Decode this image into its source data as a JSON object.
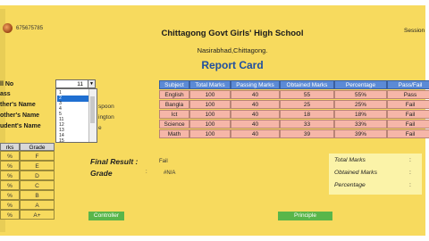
{
  "header": {
    "phone": "675675785",
    "school": "Chittagong Govt Girls' High School",
    "address": "Nasirabhad,Chittagong.",
    "report_title": "Report Card",
    "session_label": "Session"
  },
  "left_labels": {
    "roll_no": "ll No",
    "class": "ass",
    "fathers_name": "ther's Name",
    "mothers_name": "other's Name",
    "students_name": "udent's Name"
  },
  "roll_input": {
    "value": "11"
  },
  "roll_dropdown": {
    "options": [
      "1",
      "2",
      "3",
      "4",
      "5",
      "11",
      "12",
      "13",
      "14",
      "15"
    ],
    "selected_index": 1
  },
  "partial_info": [
    "spoon",
    "ington",
    "e"
  ],
  "grade_scale": {
    "headers": [
      "rks",
      "Grade"
    ],
    "rows": [
      [
        "%",
        "F"
      ],
      [
        "%",
        "E"
      ],
      [
        "%",
        "D"
      ],
      [
        "%",
        "C"
      ],
      [
        "%",
        "B"
      ],
      [
        "%",
        "A"
      ],
      [
        "%",
        "A+"
      ]
    ]
  },
  "marks_table": {
    "headers": [
      "Subject",
      "Total Marks",
      "Passing Marks",
      "Obtained Marks",
      "Percentage",
      "Pass/Fail"
    ],
    "rows": [
      [
        "English",
        "100",
        "40",
        "55",
        "55%",
        "Pass"
      ],
      [
        "Bangla",
        "100",
        "40",
        "25",
        "25%",
        "Fail"
      ],
      [
        "Ict",
        "100",
        "40",
        "18",
        "18%",
        "Fail"
      ],
      [
        "Science",
        "100",
        "40",
        "33",
        "33%",
        "Fail"
      ],
      [
        "Math",
        "100",
        "40",
        "39",
        "39%",
        "Fail"
      ]
    ]
  },
  "final_result": {
    "label": "Final Result :",
    "value": "Fail"
  },
  "grade": {
    "label": "Grade",
    "colon": ":",
    "value": "#N/A"
  },
  "totals": {
    "total_marks": "Total Marks",
    "obtained_marks": "Obtained Marks",
    "percentage": "Percentage",
    "colon": ":"
  },
  "buttons": {
    "controller": "Controller",
    "principal": "Principle"
  },
  "colors": {
    "sheet": "#f7da5e",
    "table_header": "#5b8ad6",
    "table_cell": "#f6b6a8",
    "button": "#59b64a",
    "title_blue": "#1f4fa0"
  }
}
